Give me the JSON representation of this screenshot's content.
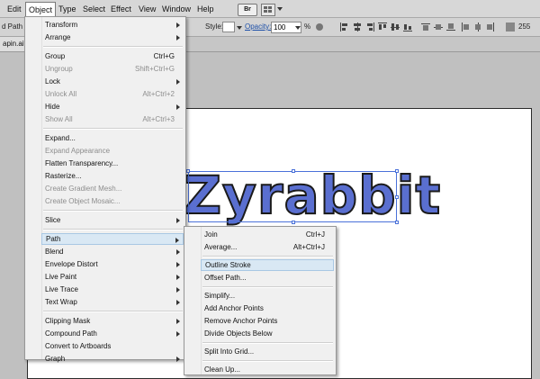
{
  "menubar": {
    "items": [
      "Edit",
      "Object",
      "Type",
      "Select",
      "Effect",
      "View",
      "Window",
      "Help"
    ],
    "bridge_label": "Br"
  },
  "controlbar": {
    "left_label": "d Path",
    "style_label": "Style:",
    "opacity_label": "Opacity:",
    "opacity_value": "100",
    "percent": "%",
    "value_right": "255"
  },
  "tabs": {
    "doc_tab": "apin.ai*"
  },
  "canvas": {
    "text": "Zyrabbit"
  },
  "object_menu": {
    "items": [
      {
        "label": "Transform",
        "submenu": true
      },
      {
        "label": "Arrange",
        "submenu": true
      },
      {
        "sep": true
      },
      {
        "label": "Group",
        "shortcut": "Ctrl+G"
      },
      {
        "label": "Ungroup",
        "shortcut": "Shift+Ctrl+G",
        "disabled": true
      },
      {
        "label": "Lock",
        "submenu": true
      },
      {
        "label": "Unlock All",
        "shortcut": "Alt+Ctrl+2",
        "disabled": true
      },
      {
        "label": "Hide",
        "submenu": true
      },
      {
        "label": "Show All",
        "shortcut": "Alt+Ctrl+3",
        "disabled": true
      },
      {
        "sep": true
      },
      {
        "label": "Expand..."
      },
      {
        "label": "Expand Appearance",
        "disabled": true
      },
      {
        "label": "Flatten Transparency..."
      },
      {
        "label": "Rasterize..."
      },
      {
        "label": "Create Gradient Mesh...",
        "disabled": true
      },
      {
        "label": "Create Object Mosaic...",
        "disabled": true
      },
      {
        "sep": true
      },
      {
        "label": "Slice",
        "submenu": true
      },
      {
        "sep": true
      },
      {
        "label": "Path",
        "submenu": true,
        "highlight": true
      },
      {
        "label": "Blend",
        "submenu": true
      },
      {
        "label": "Envelope Distort",
        "submenu": true
      },
      {
        "label": "Live Paint",
        "submenu": true
      },
      {
        "label": "Live Trace",
        "submenu": true
      },
      {
        "label": "Text Wrap",
        "submenu": true
      },
      {
        "sep": true
      },
      {
        "label": "Clipping Mask",
        "submenu": true
      },
      {
        "label": "Compound Path",
        "submenu": true
      },
      {
        "label": "Convert to Artboards"
      },
      {
        "label": "Graph",
        "submenu": true
      }
    ]
  },
  "path_menu": {
    "items": [
      {
        "label": "Join",
        "shortcut": "Ctrl+J"
      },
      {
        "label": "Average...",
        "shortcut": "Alt+Ctrl+J"
      },
      {
        "sep": true
      },
      {
        "label": "Outline Stroke",
        "highlight": true
      },
      {
        "label": "Offset Path..."
      },
      {
        "sep": true
      },
      {
        "label": "Simplify..."
      },
      {
        "label": "Add Anchor Points"
      },
      {
        "label": "Remove Anchor Points"
      },
      {
        "label": "Divide Objects Below"
      },
      {
        "sep": true
      },
      {
        "label": "Split Into Grid..."
      },
      {
        "sep": true
      },
      {
        "label": "Clean Up..."
      }
    ]
  }
}
